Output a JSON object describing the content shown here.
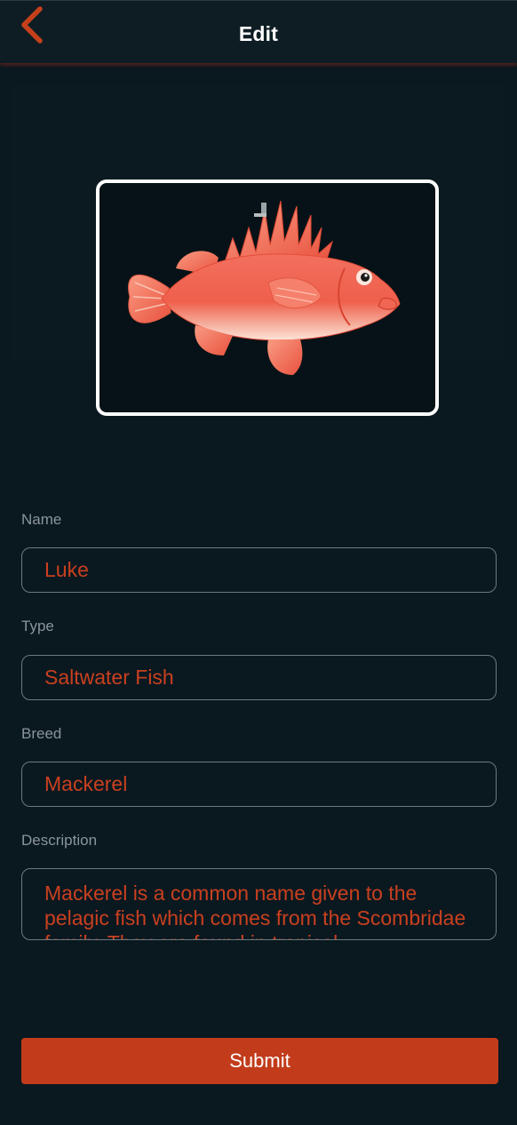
{
  "header": {
    "title": "Edit",
    "back_icon": "chevron-left-icon"
  },
  "photo": {
    "subject": "fish-image"
  },
  "form": {
    "name": {
      "label": "Name",
      "value": "Luke"
    },
    "type": {
      "label": "Type",
      "value": "Saltwater Fish"
    },
    "breed": {
      "label": "Breed",
      "value": "Mackerel"
    },
    "description": {
      "label": "Description",
      "value": "Mackerel is a common name given to the pelagic fish which comes from the Scombridae family. They are found in tropical"
    }
  },
  "actions": {
    "submit_label": "Submit"
  },
  "colors": {
    "background": "#0a1820",
    "accent": "#c23c1b",
    "input_text": "#c9401f",
    "label_text": "#8a9599"
  }
}
